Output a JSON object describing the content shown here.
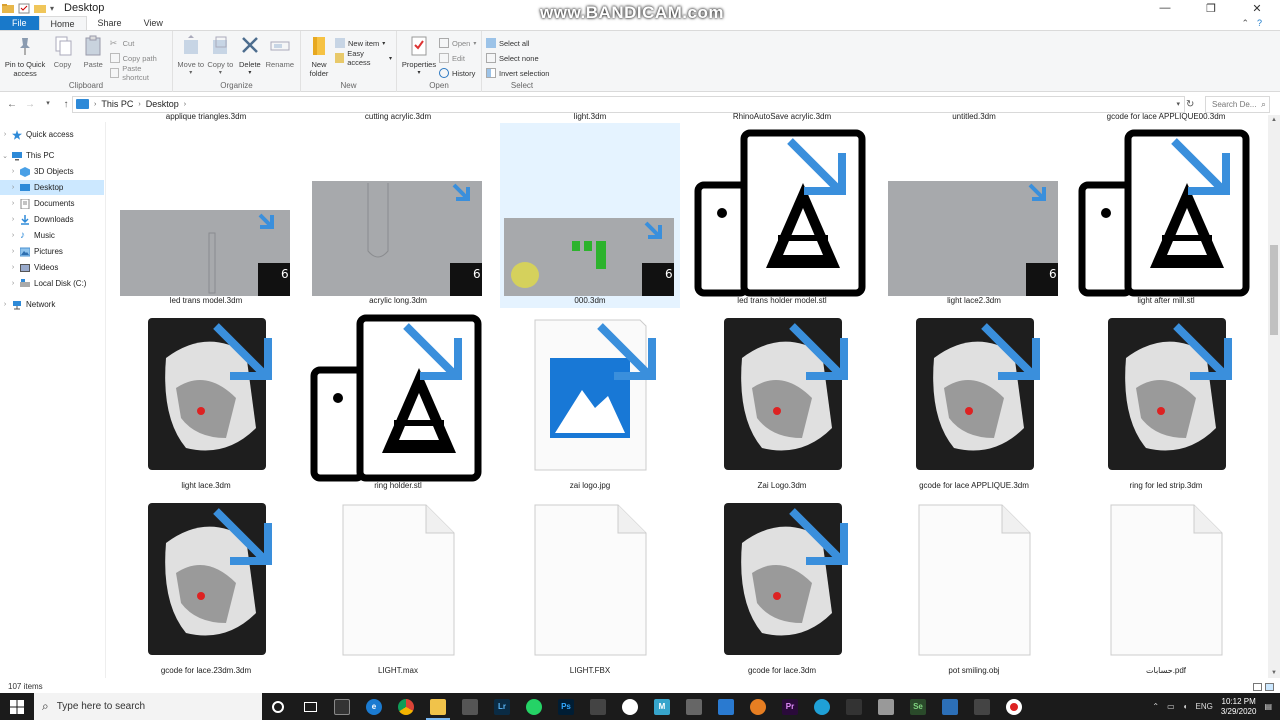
{
  "window": {
    "title": "Desktop",
    "watermark": "www.BANDICAM.com"
  },
  "ribbon_tabs": [
    "File",
    "Home",
    "Share",
    "View"
  ],
  "ribbon": {
    "clipboard": {
      "label": "Clipboard",
      "pin": "Pin to Quick access",
      "copy": "Copy",
      "paste": "Paste",
      "cut": "Cut",
      "copy_path": "Copy path",
      "paste_shortcut": "Paste shortcut"
    },
    "organize": {
      "label": "Organize",
      "move_to": "Move to",
      "copy_to": "Copy to",
      "delete": "Delete",
      "rename": "Rename"
    },
    "new": {
      "label": "New",
      "new_folder": "New folder",
      "new_item": "New item",
      "easy_access": "Easy access"
    },
    "open": {
      "label": "Open",
      "properties": "Properties",
      "open": "Open",
      "edit": "Edit",
      "history": "History"
    },
    "select": {
      "label": "Select",
      "select_all": "Select all",
      "select_none": "Select none",
      "invert": "Invert selection"
    }
  },
  "address": {
    "crumbs": [
      "This PC",
      "Desktop"
    ],
    "search_placeholder": "Search De..."
  },
  "nav_pane": {
    "quick_access": "Quick access",
    "this_pc": "This PC",
    "items": [
      "3D Objects",
      "Desktop",
      "Documents",
      "Downloads",
      "Music",
      "Pictures",
      "Videos",
      "Local Disk (C:)"
    ],
    "network": "Network"
  },
  "files": {
    "top_partial": [
      "applique triangles.3dm",
      "cutting acrylic.3dm",
      "light.3dm",
      "RhinoAutoSave acrylic.3dm",
      "untitled.3dm",
      "gcode for lace APPLIQUE00.3dm"
    ],
    "row1": [
      "led trans model.3dm",
      "acrylic long.3dm",
      "000.3dm",
      "led trans holder model.stl",
      "light lace2.3dm",
      "light after mill.stl"
    ],
    "row2": [
      "light lace.3dm",
      "ring holder.stl",
      "zai logo.jpg",
      "Zai Logo.3dm",
      "gcode for lace APPLIQUE.3dm",
      "ring for led strip.3dm"
    ],
    "row3": [
      "gcode for lace.23dm.3dm",
      "LIGHT.max",
      "LIGHT.FBX",
      "gcode for lace.3dm",
      "pot smiling.obj",
      "حسابات.pdf"
    ]
  },
  "status": {
    "item_count": "107 items"
  },
  "taskbar": {
    "search_placeholder": "Type here to search",
    "language": "ENG",
    "time": "10:12 PM",
    "date": "3/29/2020"
  },
  "colors": {
    "accent": "#1979ca",
    "selection": "#cce8ff",
    "arrow_blue": "#3a8fdc",
    "taskbar": "#1b1b1b"
  }
}
